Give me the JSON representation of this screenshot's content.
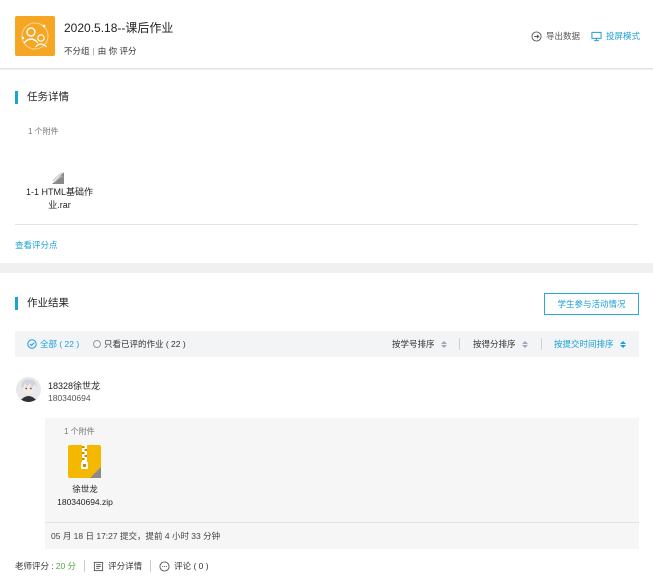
{
  "header": {
    "title": "2020.5.18--课后作业",
    "group": "不分组",
    "grader": "由 你 评分",
    "export_label": "导出数据",
    "projection_label": "投屏模式"
  },
  "task": {
    "section_title": "任务详情",
    "attachment_count": "1 个附件",
    "file_name_line1": "1-1 HTML基础作",
    "file_name_line2": "业.rar",
    "view_points_link": "查看评分点"
  },
  "results": {
    "section_title": "作业结果",
    "participation_button": "学生参与活动情况",
    "filters": {
      "all_label": "全部 ( 22 )",
      "graded_label": "只看已评的作业 ( 22 )"
    },
    "sort": {
      "by_id": "按学号排序",
      "by_score": "按得分排序",
      "by_time": "按提交时间排序"
    },
    "submission": {
      "student_name": "18328徐世龙",
      "student_id": "180340694",
      "attachment_count": "1 个附件",
      "file_name_line1": "徐世龙",
      "file_name_line2": "180340694.zip",
      "submit_time": "05 月 18 日 17:27 提交，提前 4 小时 33 分钟",
      "teacher_score_label": "老师评分 :",
      "teacher_score_value": "20 分",
      "grade_details_label": "评分详情",
      "comments_label": "评论 ( 0 )"
    }
  },
  "colors": {
    "accent": "#1a9fd6",
    "logo_orange": "#f5a623",
    "zip_yellow": "#f5b800",
    "score_green": "#53a93f"
  },
  "icons": {
    "logo": "group-people-icon",
    "export": "export-arrow-icon",
    "projection": "monitor-icon",
    "rar_file": "rar-file-icon",
    "zip_file": "zip-file-icon",
    "grade_details": "document-list-icon",
    "comments": "chat-bubble-icon"
  }
}
